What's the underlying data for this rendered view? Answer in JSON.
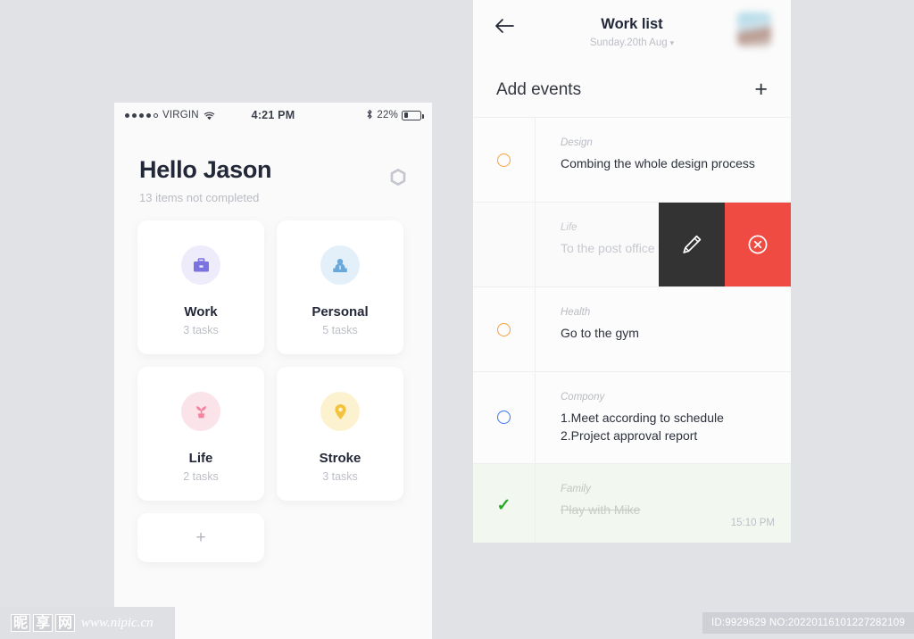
{
  "colors": {
    "page_bg": "#e1e2e6",
    "accent_orange": "#f0a13c",
    "accent_blue": "#3b77ec",
    "accent_green": "#2aa827",
    "delete_red": "#ef4b42",
    "edit_dark": "#333334",
    "work_icon": "#7b72e0",
    "personal_icon": "#6aa9db",
    "life_icon": "#f4849f",
    "stroke_icon": "#f2c33c"
  },
  "left_phone": {
    "status_bar": {
      "carrier": "VIRGIN",
      "signal_icon": "signal-dots-icon",
      "wifi_icon": "wifi-icon",
      "time": "4:21 PM",
      "bluetooth_icon": "bluetooth-icon",
      "battery_percent": "22%",
      "battery_icon": "battery-icon"
    },
    "greeting": "Hello Jason",
    "subtitle": "13 items not completed",
    "settings_icon": "hexagon-settings-icon",
    "cards": [
      {
        "title": "Work",
        "tasks": "3 tasks",
        "icon": "briefcase-icon",
        "circle_bg": "#eeebfb",
        "icon_color": "#7b72e0"
      },
      {
        "title": "Personal",
        "tasks": "5 tasks",
        "icon": "person-icon",
        "circle_bg": "#e3f0fa",
        "icon_color": "#6aa9db"
      },
      {
        "title": "Life",
        "tasks": "2 tasks",
        "icon": "plant-sprout-icon",
        "circle_bg": "#fbe3ea",
        "icon_color": "#f4849f"
      },
      {
        "title": "Stroke",
        "tasks": "3 tasks",
        "icon": "map-pin-icon",
        "circle_bg": "#fdf2cf",
        "icon_color": "#f2c33c"
      }
    ],
    "add_card_label": "+"
  },
  "right_panel": {
    "back_icon": "back-arrow-icon",
    "title": "Work list",
    "date": "Sunday.20th Aug",
    "date_chevron": "chevron-down-icon",
    "avatar": "user-avatar",
    "add_events_label": "Add events",
    "add_events_plus": "+",
    "tasks": [
      {
        "category": "Design",
        "text": "Combing the whole design process",
        "state": "open",
        "marker": "ring-orange",
        "time": ""
      },
      {
        "category": "Life",
        "text": "To the post office to take delivery",
        "state": "swiped",
        "marker": "none",
        "time": "",
        "actions": [
          {
            "name": "edit",
            "icon": "pencil-icon",
            "bg": "#333334"
          },
          {
            "name": "delete",
            "icon": "circle-x-icon",
            "bg": "#ef4b42"
          }
        ]
      },
      {
        "category": "Health",
        "text": "Go to the gym",
        "state": "open",
        "marker": "ring-orange",
        "time": ""
      },
      {
        "category": "Compony",
        "text": "1.Meet according to schedule\n2.Project approval report",
        "state": "open",
        "marker": "ring-blue",
        "time": ""
      },
      {
        "category": "Family",
        "text": "Play with Mike",
        "state": "done",
        "marker": "check-green",
        "time": "15:10 PM"
      }
    ]
  },
  "watermarks": {
    "site_cn": [
      "昵",
      "享",
      "网"
    ],
    "site_url": "www.nipic.cn",
    "id_text": "ID:9929629 NO:20220116101227282109"
  }
}
